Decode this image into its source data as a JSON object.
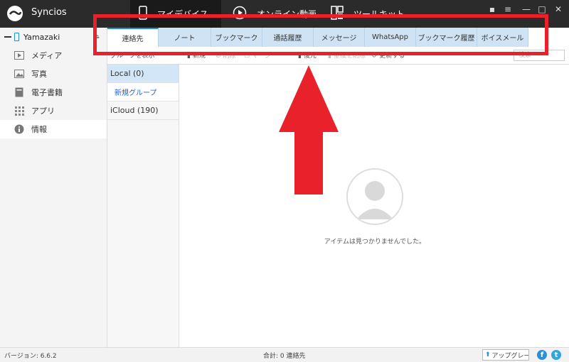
{
  "app": {
    "title": "Syncios"
  },
  "top_nav": [
    {
      "label": "マイデバイス"
    },
    {
      "label": "オンライン動画"
    },
    {
      "label": "ツールキット"
    }
  ],
  "window_controls": {
    "chat": "▪",
    "menu": "≡",
    "minimize": "—",
    "maximize": "□",
    "close": "✕"
  },
  "device": {
    "name": "Yamazaki"
  },
  "sidebar": {
    "items": [
      {
        "label": "メディア",
        "icon": "media-icon"
      },
      {
        "label": "写真",
        "icon": "photo-icon"
      },
      {
        "label": "電子書籍",
        "icon": "ebook-icon"
      },
      {
        "label": "アプリ",
        "icon": "apps-icon"
      },
      {
        "label": "情報",
        "icon": "info-icon",
        "active": true
      }
    ]
  },
  "tabs": [
    {
      "label": "連絡先",
      "active": true
    },
    {
      "label": "ノート"
    },
    {
      "label": "ブックマーク"
    },
    {
      "label": "通話履歴"
    },
    {
      "label": "メッセージ"
    },
    {
      "label": "WhatsApp"
    },
    {
      "label": "ブックマーク履歴"
    },
    {
      "label": "ボイスメール"
    }
  ],
  "toolbar": {
    "group_toggle": "グループを表示",
    "new": "新規",
    "delete": "削除",
    "merge": "マージ",
    "restore": "復元",
    "dedupe": "重複を削除",
    "refresh": "更新する",
    "search_placeholder": "検索"
  },
  "groups": {
    "local": "Local (0)",
    "new_group": "新規グループ",
    "icloud": "iCloud (190)"
  },
  "empty_state": {
    "message": "アイテムは見つかりませんでした。"
  },
  "status": {
    "version": "バージョン: 6.6.2",
    "total": "合計: 0 連絡先",
    "upgrade": "アップグレード"
  },
  "colors": {
    "accent": "#1e8fd6",
    "annotation": "#e8212b",
    "titlebar": "#2b2b2b",
    "tab_bg": "#cfe3f4"
  }
}
